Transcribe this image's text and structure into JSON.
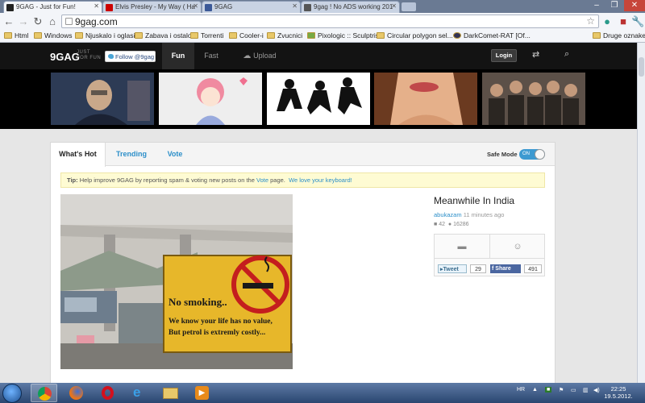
{
  "browser": {
    "tabs": [
      {
        "label": "9GAG - Just for Fun!",
        "active": true,
        "icon_color": "#222222"
      },
      {
        "label": "Elvis Presley - My Way ( Ha",
        "active": false,
        "icon_color": "#cc0000"
      },
      {
        "label": "9GAG",
        "active": false,
        "icon_color": "#3b5998"
      },
      {
        "label": "9gag ! No ADS working 201",
        "active": false,
        "icon_color": "#555555"
      }
    ],
    "address": "9gag.com",
    "bookmarks": [
      "Html",
      "Windows",
      "Njuskalo i oglasi",
      "Zabava i ostalo",
      "Torrenti",
      "Cooler-i",
      "Zvucnici",
      "Pixologic :: Sculptris",
      "Circular polygon sel...",
      "DarkComet-RAT [Of...",
      "Druge oznake"
    ]
  },
  "site": {
    "logo": "9GAG",
    "tagline_1": "JUST",
    "tagline_2": "FOR FUN",
    "follow_label": "Follow @9gag",
    "nav": [
      "Fun",
      "Fast",
      "Upload"
    ],
    "login_label": "Login"
  },
  "content": {
    "tabs": [
      "What's Hot",
      "Trending",
      "Vote"
    ],
    "safe_mode_label": "Safe Mode",
    "toggle_label": "ON",
    "tip_prefix": "Tip:",
    "tip_text": "Help improve 9GAG by reporting spam & voting new posts on the",
    "tip_vote_link": "Vote",
    "tip_page": "page.",
    "tip_keyboard_link": "We love your keyboard!",
    "sign_line_1": "No smoking..",
    "sign_line_2": "We know your life has no value,",
    "sign_line_3": "But petrol is extremly costly...",
    "post": {
      "title": "Meanwhile In India",
      "user": "abukazam",
      "time": "11 minutes ago",
      "comments": "42",
      "likes": "16286",
      "tweet_label": "Tweet",
      "tweet_count": "29",
      "share_label": "Share",
      "share_count": "491"
    }
  },
  "taskbar": {
    "lang": "HR",
    "time": "22:25",
    "date": "19.5.2012."
  }
}
